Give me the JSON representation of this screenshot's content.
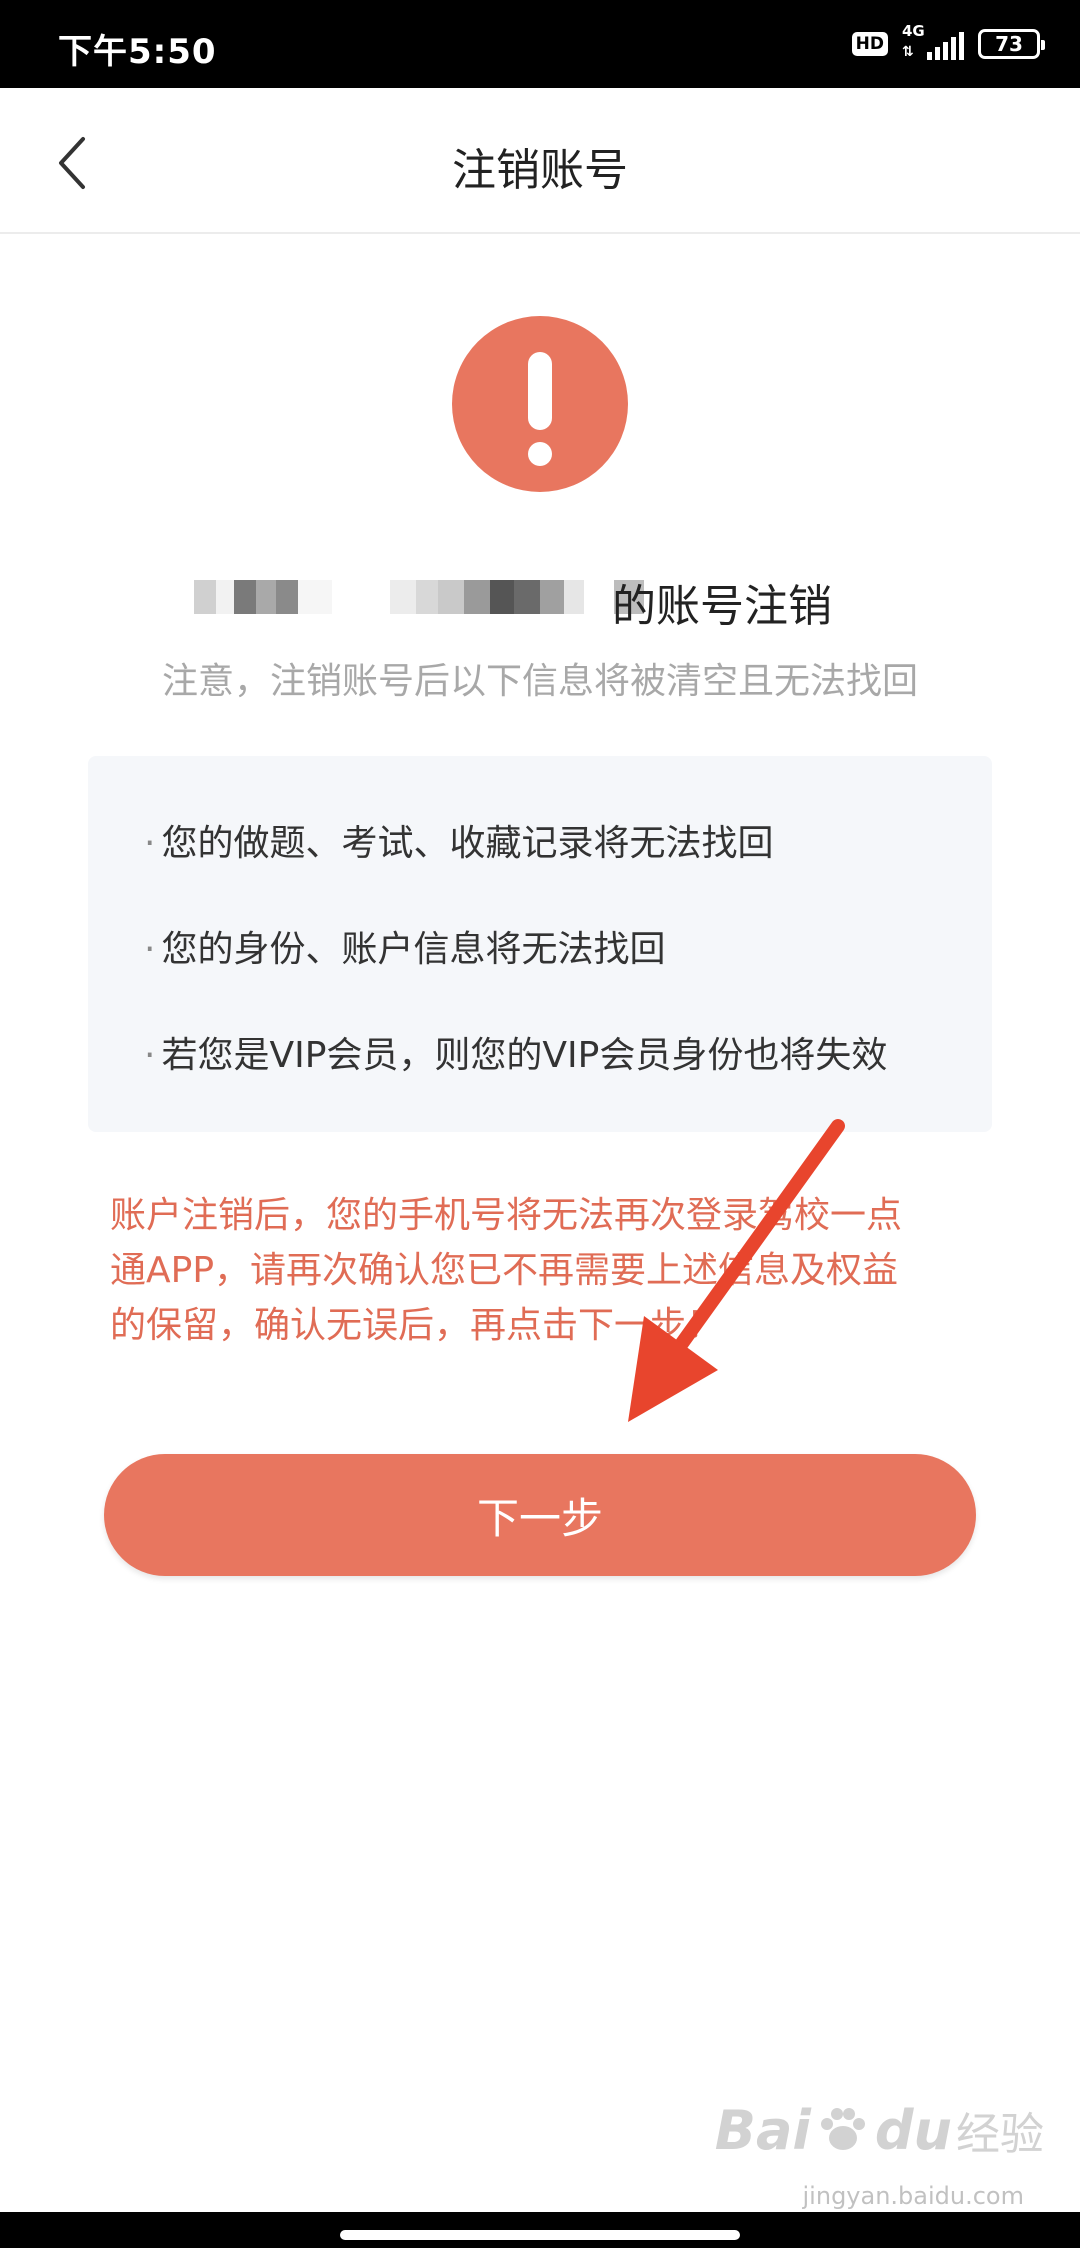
{
  "status_bar": {
    "time": "下午5:50",
    "hd": "HD",
    "network": "4G",
    "battery": "73"
  },
  "nav": {
    "title": "注销账号"
  },
  "content": {
    "headline_visible": "的账号注销",
    "notice": "注意，注销账号后以下信息将被清空且无法找回",
    "info_items": [
      "您的做题、考试、收藏记录将无法找回",
      "您的身份、账户信息将无法找回",
      "若您是VIP会员，则您的VIP会员身份也将失效"
    ],
    "warning_lines": [
      "账户注销后，您的手机号将无法再次登录驾校一点",
      "通APP，请再次确认您已不再需要上述信息及权益",
      "的保留，确认无误后，再点击下一步！"
    ],
    "next_button": "下一步"
  },
  "colors": {
    "accent": "#e8765f",
    "warning_text": "#e06c55",
    "notice_text": "#a8a8a8",
    "card_bg": "#f5f7fa",
    "annotation_arrow": "#e8452d"
  },
  "icons": {
    "alert": "exclamation-circle-icon",
    "back": "chevron-left-icon"
  },
  "watermark": {
    "logo": "Bai",
    "logo_tail": "du",
    "text": "经验",
    "site": "jingyan.baidu.com"
  }
}
